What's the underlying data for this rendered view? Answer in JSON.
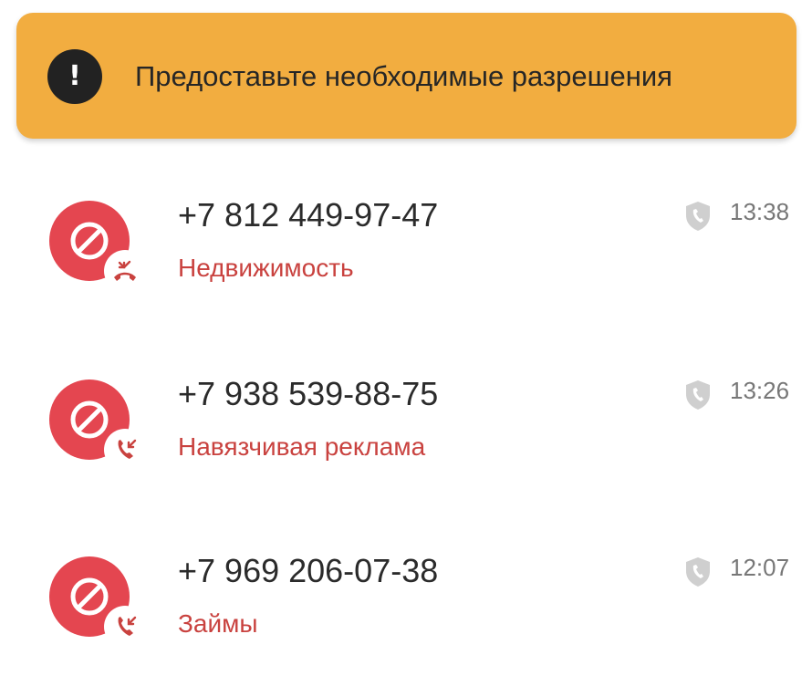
{
  "banner": {
    "icon": "exclamation-icon",
    "text": "Предоставьте необходимые разрешения",
    "background": "#f2ad40"
  },
  "calls": [
    {
      "number": "+7 812 449-97-47",
      "category": "Недвижимость",
      "time": "13:38",
      "call_type_icon": "missed-call-icon"
    },
    {
      "number": "+7 938 539-88-75",
      "category": "Навязчивая реклама",
      "time": "13:26",
      "call_type_icon": "incoming-call-icon"
    },
    {
      "number": "+7 969 206-07-38",
      "category": "Займы",
      "time": "12:07",
      "call_type_icon": "incoming-call-icon"
    }
  ],
  "colors": {
    "blocked_avatar": "#e44650",
    "category_text": "#c9423f",
    "shield": "#cfcfcf"
  }
}
